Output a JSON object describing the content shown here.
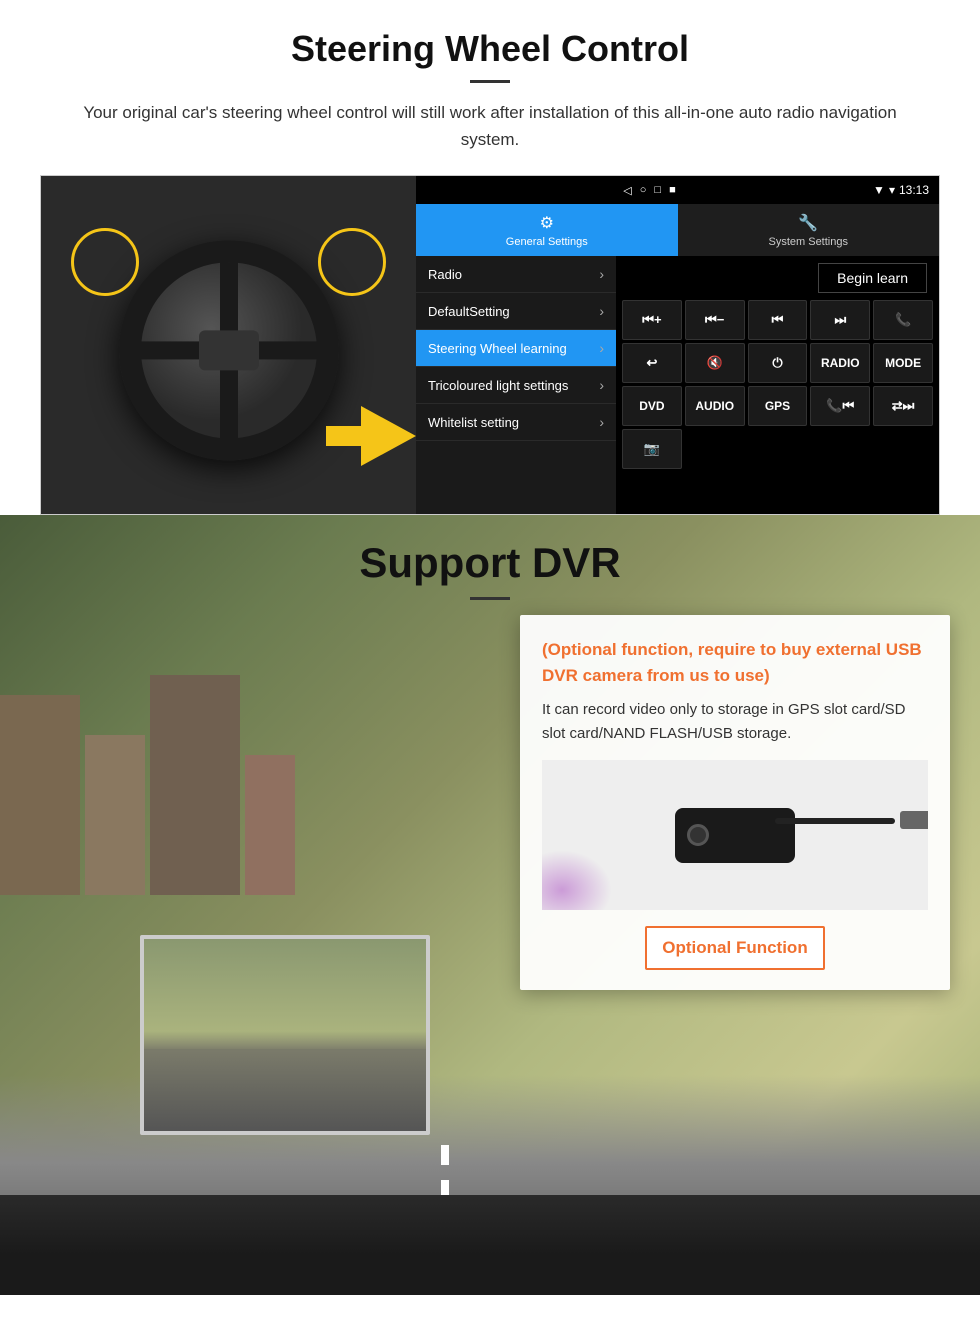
{
  "steering": {
    "title": "Steering Wheel Control",
    "subtitle": "Your original car's steering wheel control will still work after installation of this all-in-one auto radio navigation system.",
    "statusbar": {
      "time": "13:13",
      "icons": [
        "◁",
        "○",
        "□",
        "■"
      ]
    },
    "tabs": [
      {
        "id": "general",
        "label": "General Settings",
        "icon": "⚙",
        "active": true
      },
      {
        "id": "system",
        "label": "System Settings",
        "icon": "🔧",
        "active": false
      }
    ],
    "menu_items": [
      {
        "label": "Radio",
        "active": false
      },
      {
        "label": "DefaultSetting",
        "active": false
      },
      {
        "label": "Steering Wheel learning",
        "active": true
      },
      {
        "label": "Tricoloured light settings",
        "active": false
      },
      {
        "label": "Whitelist setting",
        "active": false
      }
    ],
    "begin_learn": "Begin learn",
    "control_buttons": [
      "⏮+",
      "⏮-",
      "⏮⏮",
      "⏭⏭",
      "📞",
      "↩",
      "🔇",
      "⏻",
      "RADIO",
      "MODE",
      "DVD",
      "AUDIO",
      "GPS",
      "📞⏮",
      "🔀⏭"
    ],
    "control_buttons_row3": [
      "📷"
    ]
  },
  "dvr": {
    "title": "Support DVR",
    "optional_heading": "(Optional function, require to buy external USB DVR camera from us to use)",
    "description": "It can record video only to storage in GPS slot card/SD slot card/NAND FLASH/USB storage.",
    "optional_btn_label": "Optional Function"
  }
}
